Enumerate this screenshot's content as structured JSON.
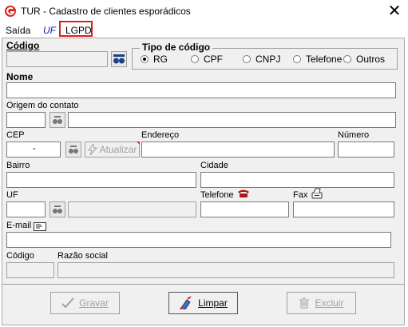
{
  "window": {
    "title": "TUR - Cadastro de clientes esporádicos",
    "close_glyph": "✕"
  },
  "menu": {
    "items": [
      {
        "label": "Saída"
      },
      {
        "label": "UF"
      },
      {
        "label": "LGPD"
      }
    ]
  },
  "form": {
    "codigo_label": "Código",
    "tipo_codigo": {
      "label": "Tipo de código",
      "options": [
        "RG",
        "CPF",
        "CNPJ",
        "Telefone",
        "Outros"
      ],
      "selected": "RG"
    },
    "nome_label": "Nome",
    "origem_label": "Origem do contato",
    "cep_label": "CEP",
    "cep_value": "-",
    "atualizar_label": "Atualizar",
    "endereco_label": "Endereço",
    "numero_label": "Número",
    "bairro_label": "Bairro",
    "cidade_label": "Cidade",
    "uf_label": "UF",
    "telefone_label": "Telefone",
    "fax_label": "Fax",
    "email_label": "E-mail",
    "codigo2_label": "Código",
    "razao_label": "Razão social"
  },
  "buttons": {
    "gravar": "Gravar",
    "limpar": "Limpar",
    "excluir": "Excluir"
  },
  "colors": {
    "highlight": "#e01b24",
    "uf_menu": "#1a1aa6"
  }
}
